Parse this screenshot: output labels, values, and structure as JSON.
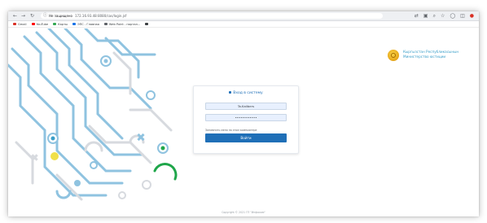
{
  "browser": {
    "nav_back": "←",
    "nav_forward": "→",
    "reload": "↻",
    "lock": "ⓘ",
    "site_name": "Не защищено",
    "url": "172.16.93.48:8080/cas/login.jsf",
    "bookmarks": [
      {
        "label": "Gmail",
        "color": "#d93025"
      },
      {
        "label": "YouTube",
        "color": "#ff0000"
      },
      {
        "label": "Карты",
        "color": "#34a853"
      },
      {
        "label": "ЭПС - Главная",
        "color": "#1a73e8"
      },
      {
        "label": "Web Point - портал...",
        "color": "#5f6368"
      },
      {
        "label": "",
        "color": "#3c4043"
      }
    ]
  },
  "header": {
    "org_line1": "Кыргызстан Республикасынын",
    "org_line2": "Министерство юстиции"
  },
  "login": {
    "title": "Вход в систему",
    "username_value": "Ta.Kalibers",
    "password_value": "••••••••••••",
    "remember_label": "Запомнить меня на этом компьютере",
    "submit_label": "Войти"
  },
  "footer": {
    "text": "Copyright © 2021 ГП \"Инфоком\""
  },
  "colors": {
    "accent": "#1f6fb7",
    "deco_blue": "#8fc3e0",
    "deco_gray": "#d7dadf",
    "deco_green": "#1fa64a",
    "deco_yellow": "#f0e04a"
  }
}
